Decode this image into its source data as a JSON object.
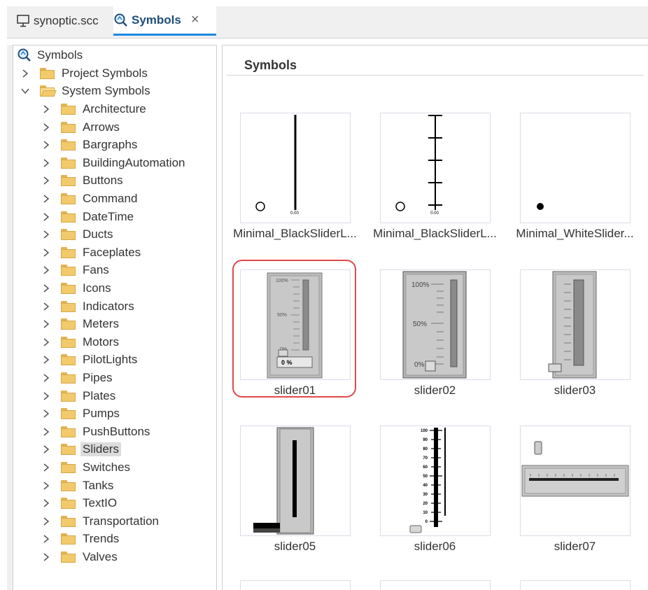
{
  "tabs": [
    {
      "label": "synoptic.scc",
      "icon": "monitor-icon",
      "active": false
    },
    {
      "label": "Symbols",
      "icon": "symbols-search-icon",
      "active": true,
      "close": "×"
    }
  ],
  "tree": {
    "root": "Symbols",
    "project": "Project Symbols",
    "system": "System Symbols",
    "selected": "Sliders",
    "items": [
      "Architecture",
      "Arrows",
      "Bargraphs",
      "BuildingAutomation",
      "Buttons",
      "Command",
      "DateTime",
      "Ducts",
      "Faceplates",
      "Fans",
      "Icons",
      "Indicators",
      "Meters",
      "Motors",
      "PilotLights",
      "Pipes",
      "Plates",
      "Pumps",
      "PushButtons",
      "Sliders",
      "Switches",
      "Tanks",
      "TextIO",
      "Transportation",
      "Trends",
      "Valves"
    ]
  },
  "symbols_panel": {
    "title": "Symbols",
    "highlight_color": "#e0484a",
    "symbols": [
      {
        "label": "Minimal_BlackSliderL...",
        "readout": "0.00"
      },
      {
        "label": "Minimal_BlackSliderL...",
        "readout": "0.00"
      },
      {
        "label": "Minimal_WhiteSlider..."
      },
      {
        "label": "slider01",
        "ticks": [
          "100%",
          "50%",
          "0%"
        ],
        "readout": "0 %"
      },
      {
        "label": "slider02",
        "ticks": [
          "100%",
          "50%",
          "0%"
        ]
      },
      {
        "label": "slider03"
      },
      {
        "label": "slider05"
      },
      {
        "label": "slider06",
        "scale": [
          "100",
          "90",
          "80",
          "70",
          "60",
          "50",
          "40",
          "30",
          "20",
          "10",
          "0"
        ]
      },
      {
        "label": "slider07"
      }
    ]
  }
}
